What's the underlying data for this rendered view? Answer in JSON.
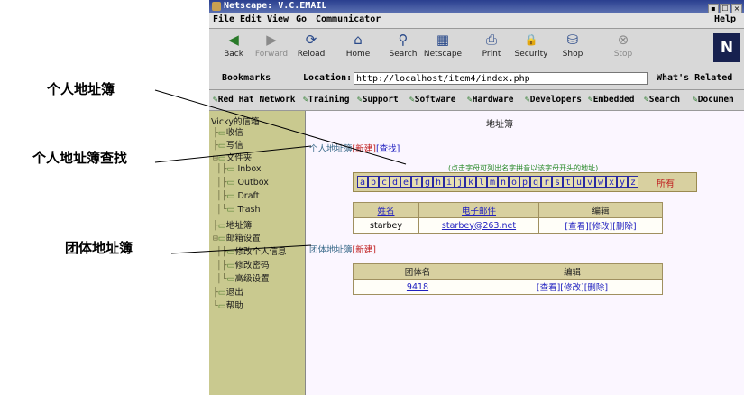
{
  "annotations": {
    "personal_book": "个人地址簿",
    "personal_search": "个人地址簿查找",
    "group_book": "团体地址簿"
  },
  "window": {
    "title": "Netscape: V.C.EMAIL",
    "controls": [
      "▪",
      "☐",
      "×"
    ]
  },
  "menu": [
    "File",
    "Edit",
    "View",
    "Go",
    "Communicator",
    "Help"
  ],
  "toolbar": [
    {
      "label": "Back",
      "icon": "back-arrow-icon",
      "glyph": "◀",
      "enabled": true
    },
    {
      "label": "Forward",
      "icon": "forward-arrow-icon",
      "glyph": "▶",
      "enabled": false
    },
    {
      "label": "Reload",
      "icon": "reload-icon",
      "glyph": "⟳",
      "enabled": true
    },
    {
      "label": "Home",
      "icon": "home-icon",
      "glyph": "⌂",
      "enabled": true
    },
    {
      "label": "Search",
      "icon": "search-icon",
      "glyph": "⚲",
      "enabled": true
    },
    {
      "label": "Netscape",
      "icon": "netscape-icon",
      "glyph": "▦",
      "enabled": true
    },
    {
      "label": "Print",
      "icon": "print-icon",
      "glyph": "⎙",
      "enabled": true
    },
    {
      "label": "Security",
      "icon": "security-lock-icon",
      "glyph": "🔒",
      "enabled": true
    },
    {
      "label": "Shop",
      "icon": "shop-icon",
      "glyph": "⛁",
      "enabled": true
    },
    {
      "label": "Stop",
      "icon": "stop-icon",
      "glyph": "⊗",
      "enabled": false
    }
  ],
  "logo": "N",
  "location": {
    "bookmarks_label": "Bookmarks",
    "location_label": "Location:",
    "url": "http://localhost/item4/index.php",
    "related_label": "What's Related"
  },
  "personal_toolbar": [
    "Red Hat Network",
    "Training",
    "Support",
    "Software",
    "Hardware",
    "Developers",
    "Embedded",
    "Search",
    "Documen"
  ],
  "tree": [
    {
      "label": "Vicky的信箱",
      "indent": 0
    },
    {
      "label": "收信",
      "indent": 1
    },
    {
      "label": "写信",
      "indent": 1
    },
    {
      "label": "文件夹",
      "indent": 1
    },
    {
      "label": "Inbox",
      "indent": 2
    },
    {
      "label": "Outbox",
      "indent": 2
    },
    {
      "label": "Draft",
      "indent": 2
    },
    {
      "label": "Trash",
      "indent": 2
    },
    {
      "label": "地址簿",
      "indent": 1
    },
    {
      "label": "邮箱设置",
      "indent": 1
    },
    {
      "label": "修改个人信息",
      "indent": 2
    },
    {
      "label": "修改密码",
      "indent": 2
    },
    {
      "label": "高级设置",
      "indent": 2
    },
    {
      "label": "退出",
      "indent": 1
    },
    {
      "label": "帮助",
      "indent": 1
    }
  ],
  "main": {
    "title": "地址簿",
    "personal_section": "个人地址簿",
    "personal_add": "[新建]",
    "personal_search": "[查找]",
    "alpha_note": "(点击字母可列出名字拼音以该字母开头的地址)",
    "letters": [
      "a",
      "b",
      "c",
      "d",
      "e",
      "f",
      "g",
      "h",
      "i",
      "j",
      "k",
      "l",
      "m",
      "n",
      "o",
      "p",
      "q",
      "r",
      "s",
      "t",
      "u",
      "v",
      "w",
      "x",
      "y",
      "z"
    ],
    "all_label": "所有",
    "personal_table": {
      "headers": [
        "姓名",
        "电子邮件",
        "编辑"
      ],
      "rows": [
        {
          "name": "starbey",
          "email": "starbey@263.net",
          "view": "[查看]",
          "edit": "[修改]",
          "delete": "[删除]"
        }
      ]
    },
    "group_section": "团体地址簿",
    "group_add": "[新建]",
    "group_table": {
      "headers": [
        "团体名",
        "编辑"
      ],
      "rows": [
        {
          "name": "9418",
          "view": "[查看]",
          "edit": "[修改]",
          "delete": "[删除]"
        }
      ]
    }
  }
}
